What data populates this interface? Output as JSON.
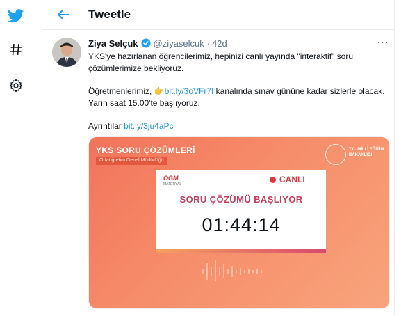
{
  "rail": {
    "twitter_icon": "twitter-bird-icon",
    "explore_icon": "hashtag-icon",
    "settings_icon": "gear-icon"
  },
  "header": {
    "title": "Tweetle",
    "back_icon": "arrow-left-icon"
  },
  "tweet": {
    "author_name": "Ziya Selçuk",
    "handle": "@ziyaselcuk",
    "separator": "·",
    "age": "42d",
    "more_icon": "more-icon",
    "more_label": "···",
    "paragraph1": "YKS'ye hazırlanan öğrencilerimiz, hepinizi canlı yayında \"interaktif\" soru çözümlerimize bekliyoruz.",
    "p2_before": "Öğretmenlerimiz, ",
    "p2_emoji": "👉",
    "p2_link": "bit.ly/3oVFr7I",
    "p2_after": " kanalında sınav gününe kadar sizlerle olacak. Yarın saat 15.00'te başlıyoruz.",
    "p3_before": "Ayrıntılar ",
    "p3_link": "bit.ly/3ju4aPc"
  },
  "media": {
    "title": "YKS SORU ÇÖZÜMLERİ",
    "subtitle": "Ortaöğretim Genel Müdürlüğü",
    "ministry_line1": "T.C. MİLLÎ EĞİTİM",
    "ministry_line2": "BAKANLIĞI",
    "ogm_logo": "OGM",
    "ogm_sub": "MATERYAL",
    "live_label": "CANLI",
    "heading": "SORU ÇÖZÜMÜ BAŞLIYOR",
    "countdown": "01:44:14"
  },
  "colors": {
    "accent": "#1da1f2",
    "link": "#1b95e0",
    "live": "#e0353a"
  }
}
